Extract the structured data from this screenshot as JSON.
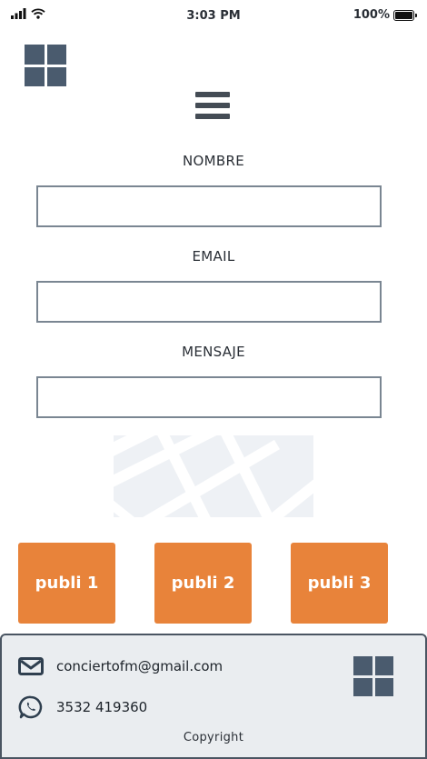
{
  "status_bar": {
    "time": "3:03 PM",
    "battery_text": "100%",
    "battery_level": 1.0,
    "signal_icon": "signal-icon",
    "wifi_icon": "wifi-icon",
    "battery_icon": "battery-icon"
  },
  "header": {
    "logo_icon": "logo-grid-icon",
    "menu_icon": "hamburger-menu-icon"
  },
  "form": {
    "name_label": "NOMBRE",
    "name_value": "",
    "email_label": "EMAIL",
    "email_value": "",
    "message_label": "MENSAJE",
    "message_value": ""
  },
  "map": {
    "icon": "map-placeholder-icon"
  },
  "ads": [
    {
      "label": "publi 1"
    },
    {
      "label": "publi 2"
    },
    {
      "label": "publi 3"
    }
  ],
  "footer": {
    "email": "conciertofm@gmail.com",
    "email_icon": "envelope-icon",
    "phone": "3532 419360",
    "phone_icon": "whatsapp-icon",
    "logo_icon": "logo-grid-icon",
    "copyright": "Copyright"
  },
  "colors": {
    "accent": "#e8833a",
    "logo": "#4a5b6e",
    "footer_bg": "#eaedf0",
    "input_border": "#7a8692"
  }
}
